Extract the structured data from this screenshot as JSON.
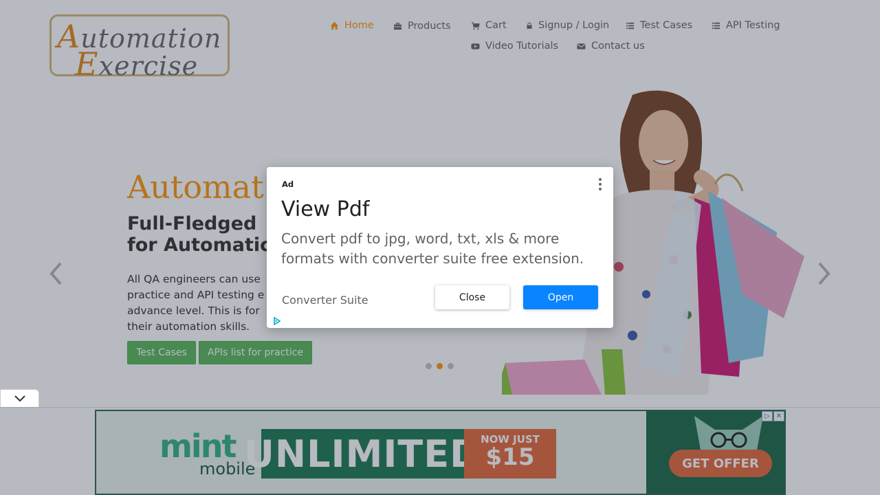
{
  "header": {
    "logo_line1": "Automation",
    "logo_line2": "Exercise",
    "nav": [
      {
        "label": "Home",
        "icon": "home-icon"
      },
      {
        "label": "Products",
        "icon": "briefcase-icon"
      },
      {
        "label": "Cart",
        "icon": "cart-icon"
      },
      {
        "label": "Signup / Login",
        "icon": "lock-icon"
      },
      {
        "label": "Test Cases",
        "icon": "list-icon"
      },
      {
        "label": "API Testing",
        "icon": "list-icon"
      },
      {
        "label": "Video Tutorials",
        "icon": "youtube-icon"
      },
      {
        "label": "Contact us",
        "icon": "envelope-icon"
      }
    ],
    "active_color": "#fe980f"
  },
  "hero": {
    "title": "Automat",
    "subtitle_line1": "Full-Fledged",
    "subtitle_line2": "for Automatic",
    "text_line1": "All QA engineers can use",
    "text_line2": "practice and API testing e",
    "text_line3": "advance level. This is for",
    "text_line4": "their automation skills.",
    "btn_test_cases": "Test Cases",
    "btn_apis": "APIs list for practice",
    "carousel_active_index": 1,
    "carousel_count": 3
  },
  "modal": {
    "ad_label": "Ad",
    "title": "View Pdf",
    "description": "Convert pdf to jpg, word, txt, xls & more formats with converter suite free extension.",
    "brand": "Converter Suite",
    "close_label": "Close",
    "open_label": "Open"
  },
  "banner": {
    "brand_top": "mint",
    "brand_bottom": "mobile",
    "headline": "UNLIMITED",
    "price_prefix": "NOW JUST",
    "price": "$15",
    "cta": "GET OFFER"
  }
}
